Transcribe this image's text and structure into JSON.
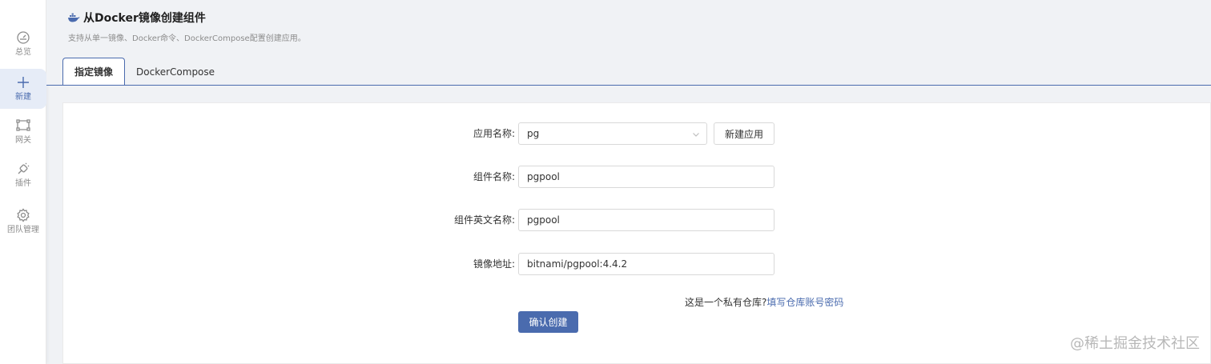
{
  "sidebar": {
    "items": [
      {
        "label": "总览",
        "icon": "dashboard-icon"
      },
      {
        "label": "新建",
        "icon": "plus-icon"
      },
      {
        "label": "网关",
        "icon": "gateway-icon"
      },
      {
        "label": "插件",
        "icon": "plugin-icon"
      },
      {
        "label": "团队管理",
        "icon": "gear-icon"
      }
    ],
    "active_index": 1
  },
  "header": {
    "title": "从Docker镜像创建组件",
    "subtitle": "支持从单一镜像、Docker命令、DockerCompose配置创建应用。"
  },
  "tabs": [
    {
      "label": "指定镜像",
      "active": true
    },
    {
      "label": "DockerCompose",
      "active": false
    }
  ],
  "form": {
    "app_name_label": "应用名称:",
    "app_name_value": "pg",
    "new_app_button": "新建应用",
    "component_name_label": "组件名称:",
    "component_name_value": "pgpool",
    "component_en_name_label": "组件英文名称:",
    "component_en_name_value": "pgpool",
    "image_address_label": "镜像地址:",
    "image_address_value": "bitnami/pgpool:4.4.2",
    "private_repo_question": "这是一个私有仓库?",
    "private_repo_link": "填写仓库账号密码",
    "submit_button": "确认创建"
  },
  "watermark": "@稀土掘金技术社区",
  "colors": {
    "accent": "#4a6bae",
    "background": "#f0f2f5",
    "border": "#d9d9d9"
  }
}
